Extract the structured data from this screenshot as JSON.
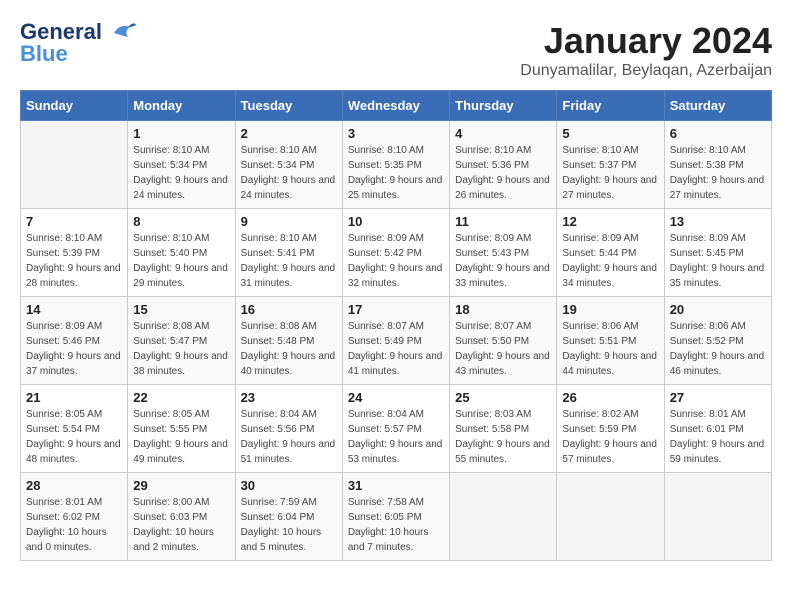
{
  "header": {
    "logo_line1": "General",
    "logo_line2": "Blue",
    "month_title": "January 2024",
    "location": "Dunyamalilar, Beylaqan, Azerbaijan"
  },
  "weekdays": [
    "Sunday",
    "Monday",
    "Tuesday",
    "Wednesday",
    "Thursday",
    "Friday",
    "Saturday"
  ],
  "weeks": [
    [
      {
        "day": "",
        "sunrise": "",
        "sunset": "",
        "daylight": ""
      },
      {
        "day": "1",
        "sunrise": "Sunrise: 8:10 AM",
        "sunset": "Sunset: 5:34 PM",
        "daylight": "Daylight: 9 hours and 24 minutes."
      },
      {
        "day": "2",
        "sunrise": "Sunrise: 8:10 AM",
        "sunset": "Sunset: 5:34 PM",
        "daylight": "Daylight: 9 hours and 24 minutes."
      },
      {
        "day": "3",
        "sunrise": "Sunrise: 8:10 AM",
        "sunset": "Sunset: 5:35 PM",
        "daylight": "Daylight: 9 hours and 25 minutes."
      },
      {
        "day": "4",
        "sunrise": "Sunrise: 8:10 AM",
        "sunset": "Sunset: 5:36 PM",
        "daylight": "Daylight: 9 hours and 26 minutes."
      },
      {
        "day": "5",
        "sunrise": "Sunrise: 8:10 AM",
        "sunset": "Sunset: 5:37 PM",
        "daylight": "Daylight: 9 hours and 27 minutes."
      },
      {
        "day": "6",
        "sunrise": "Sunrise: 8:10 AM",
        "sunset": "Sunset: 5:38 PM",
        "daylight": "Daylight: 9 hours and 27 minutes."
      }
    ],
    [
      {
        "day": "7",
        "sunrise": "Sunrise: 8:10 AM",
        "sunset": "Sunset: 5:39 PM",
        "daylight": "Daylight: 9 hours and 28 minutes."
      },
      {
        "day": "8",
        "sunrise": "Sunrise: 8:10 AM",
        "sunset": "Sunset: 5:40 PM",
        "daylight": "Daylight: 9 hours and 29 minutes."
      },
      {
        "day": "9",
        "sunrise": "Sunrise: 8:10 AM",
        "sunset": "Sunset: 5:41 PM",
        "daylight": "Daylight: 9 hours and 31 minutes."
      },
      {
        "day": "10",
        "sunrise": "Sunrise: 8:09 AM",
        "sunset": "Sunset: 5:42 PM",
        "daylight": "Daylight: 9 hours and 32 minutes."
      },
      {
        "day": "11",
        "sunrise": "Sunrise: 8:09 AM",
        "sunset": "Sunset: 5:43 PM",
        "daylight": "Daylight: 9 hours and 33 minutes."
      },
      {
        "day": "12",
        "sunrise": "Sunrise: 8:09 AM",
        "sunset": "Sunset: 5:44 PM",
        "daylight": "Daylight: 9 hours and 34 minutes."
      },
      {
        "day": "13",
        "sunrise": "Sunrise: 8:09 AM",
        "sunset": "Sunset: 5:45 PM",
        "daylight": "Daylight: 9 hours and 35 minutes."
      }
    ],
    [
      {
        "day": "14",
        "sunrise": "Sunrise: 8:09 AM",
        "sunset": "Sunset: 5:46 PM",
        "daylight": "Daylight: 9 hours and 37 minutes."
      },
      {
        "day": "15",
        "sunrise": "Sunrise: 8:08 AM",
        "sunset": "Sunset: 5:47 PM",
        "daylight": "Daylight: 9 hours and 38 minutes."
      },
      {
        "day": "16",
        "sunrise": "Sunrise: 8:08 AM",
        "sunset": "Sunset: 5:48 PM",
        "daylight": "Daylight: 9 hours and 40 minutes."
      },
      {
        "day": "17",
        "sunrise": "Sunrise: 8:07 AM",
        "sunset": "Sunset: 5:49 PM",
        "daylight": "Daylight: 9 hours and 41 minutes."
      },
      {
        "day": "18",
        "sunrise": "Sunrise: 8:07 AM",
        "sunset": "Sunset: 5:50 PM",
        "daylight": "Daylight: 9 hours and 43 minutes."
      },
      {
        "day": "19",
        "sunrise": "Sunrise: 8:06 AM",
        "sunset": "Sunset: 5:51 PM",
        "daylight": "Daylight: 9 hours and 44 minutes."
      },
      {
        "day": "20",
        "sunrise": "Sunrise: 8:06 AM",
        "sunset": "Sunset: 5:52 PM",
        "daylight": "Daylight: 9 hours and 46 minutes."
      }
    ],
    [
      {
        "day": "21",
        "sunrise": "Sunrise: 8:05 AM",
        "sunset": "Sunset: 5:54 PM",
        "daylight": "Daylight: 9 hours and 48 minutes."
      },
      {
        "day": "22",
        "sunrise": "Sunrise: 8:05 AM",
        "sunset": "Sunset: 5:55 PM",
        "daylight": "Daylight: 9 hours and 49 minutes."
      },
      {
        "day": "23",
        "sunrise": "Sunrise: 8:04 AM",
        "sunset": "Sunset: 5:56 PM",
        "daylight": "Daylight: 9 hours and 51 minutes."
      },
      {
        "day": "24",
        "sunrise": "Sunrise: 8:04 AM",
        "sunset": "Sunset: 5:57 PM",
        "daylight": "Daylight: 9 hours and 53 minutes."
      },
      {
        "day": "25",
        "sunrise": "Sunrise: 8:03 AM",
        "sunset": "Sunset: 5:58 PM",
        "daylight": "Daylight: 9 hours and 55 minutes."
      },
      {
        "day": "26",
        "sunrise": "Sunrise: 8:02 AM",
        "sunset": "Sunset: 5:59 PM",
        "daylight": "Daylight: 9 hours and 57 minutes."
      },
      {
        "day": "27",
        "sunrise": "Sunrise: 8:01 AM",
        "sunset": "Sunset: 6:01 PM",
        "daylight": "Daylight: 9 hours and 59 minutes."
      }
    ],
    [
      {
        "day": "28",
        "sunrise": "Sunrise: 8:01 AM",
        "sunset": "Sunset: 6:02 PM",
        "daylight": "Daylight: 10 hours and 0 minutes."
      },
      {
        "day": "29",
        "sunrise": "Sunrise: 8:00 AM",
        "sunset": "Sunset: 6:03 PM",
        "daylight": "Daylight: 10 hours and 2 minutes."
      },
      {
        "day": "30",
        "sunrise": "Sunrise: 7:59 AM",
        "sunset": "Sunset: 6:04 PM",
        "daylight": "Daylight: 10 hours and 5 minutes."
      },
      {
        "day": "31",
        "sunrise": "Sunrise: 7:58 AM",
        "sunset": "Sunset: 6:05 PM",
        "daylight": "Daylight: 10 hours and 7 minutes."
      },
      {
        "day": "",
        "sunrise": "",
        "sunset": "",
        "daylight": ""
      },
      {
        "day": "",
        "sunrise": "",
        "sunset": "",
        "daylight": ""
      },
      {
        "day": "",
        "sunrise": "",
        "sunset": "",
        "daylight": ""
      }
    ]
  ]
}
